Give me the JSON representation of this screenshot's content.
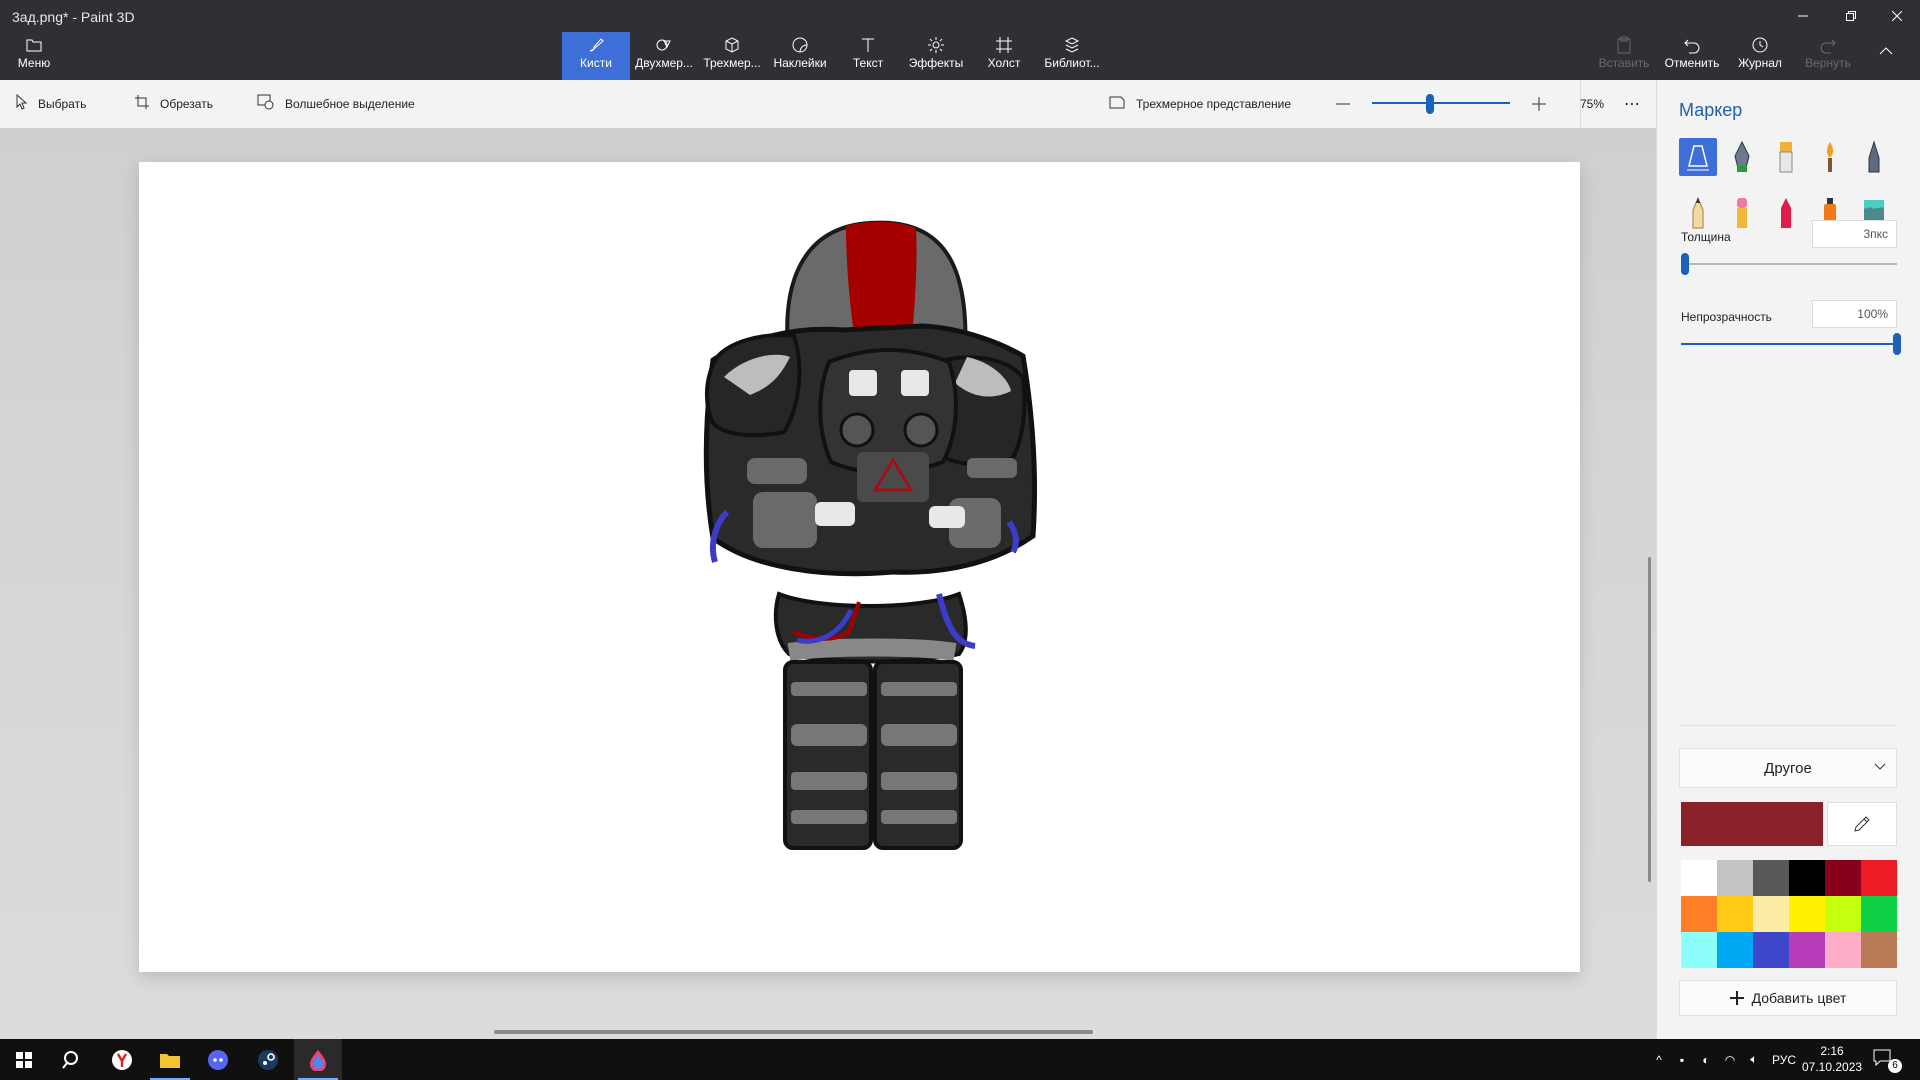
{
  "window": {
    "title": "3ад.png* - Paint 3D",
    "controls": [
      "minimize",
      "restore",
      "close"
    ]
  },
  "menu": {
    "label": "Меню",
    "icon": "folder-icon"
  },
  "main_tools": [
    {
      "label": "Кисти",
      "icon": "brush-icon",
      "active": true
    },
    {
      "label": "Двухмер...",
      "icon": "2d-shapes-icon",
      "active": false
    },
    {
      "label": "Трехмер...",
      "icon": "3d-shapes-icon",
      "active": false
    },
    {
      "label": "Наклейки",
      "icon": "stickers-icon",
      "active": false
    },
    {
      "label": "Текст",
      "icon": "text-icon",
      "active": false
    },
    {
      "label": "Эффекты",
      "icon": "effects-icon",
      "active": false
    },
    {
      "label": "Холст",
      "icon": "canvas-icon",
      "active": false
    },
    {
      "label": "Библиот...",
      "icon": "library-icon",
      "active": false
    }
  ],
  "actions": [
    {
      "label": "Вставить",
      "icon": "paste-icon",
      "enabled": false
    },
    {
      "label": "Отменить",
      "icon": "undo-icon",
      "enabled": true
    },
    {
      "label": "Журнал",
      "icon": "history-icon",
      "enabled": true
    },
    {
      "label": "Вернуть",
      "icon": "redo-icon",
      "enabled": false
    }
  ],
  "subtoolbar": {
    "select": "Выбрать",
    "crop": "Обрезать",
    "magic_select": "Волшебное выделение",
    "view_3d": "Трехмерное представление",
    "zoom_value": "75%",
    "zoom_level": 0.42
  },
  "panel": {
    "title": "Маркер",
    "brushes": [
      "marker",
      "calligraphy-pen",
      "oil-brush",
      "watercolor",
      "pixel-pen",
      "pencil",
      "eraser",
      "crayon",
      "spray-can",
      "fill"
    ],
    "selected_brush": "marker",
    "thickness_label": "Толщина",
    "thickness_value": "3пкс",
    "thickness_level": 0.02,
    "opacity_label": "Непрозрачность",
    "opacity_value": "100%",
    "opacity_level": 1.0,
    "color_dropdown": "Другое",
    "current_color": "#8b2229",
    "palette": [
      "#ffffff",
      "#c3c3c3",
      "#585858",
      "#000000",
      "#88001b",
      "#ec1c24",
      "#ff7f27",
      "#ffca18",
      "#fdeca6",
      "#fff200",
      "#c4ff0e",
      "#0ed145",
      "#8cfffb",
      "#00a8f3",
      "#3f48cc",
      "#b83dba",
      "#ffaec8",
      "#b97a56"
    ],
    "add_color": "Добавить цвет"
  },
  "taskbar": {
    "apps": [
      "windows-start-icon",
      "search-icon",
      "yandex-browser-icon",
      "file-explorer-icon",
      "discord-icon",
      "steam-icon",
      "paint-3d-icon"
    ],
    "language": "РУС",
    "time": "2:16",
    "date": "07.10.2023",
    "notification_count": "6"
  }
}
